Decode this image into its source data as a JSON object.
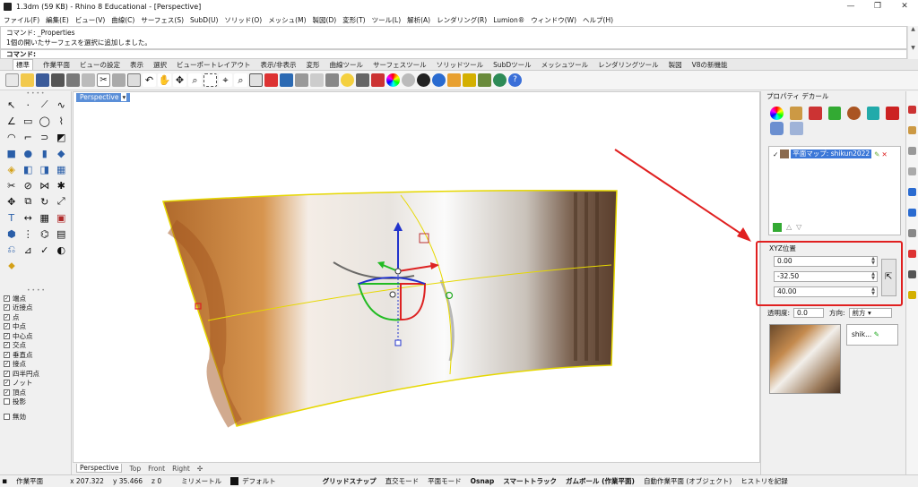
{
  "window": {
    "title": "1.3dm (59 KB) - Rhino 8 Educational - [Perspective]",
    "min": "—",
    "max": "❐",
    "close": "✕"
  },
  "menu": [
    "ファイル(F)",
    "編集(E)",
    "ビュー(V)",
    "曲線(C)",
    "サーフェス(S)",
    "SubD(U)",
    "ソリッド(O)",
    "メッシュ(M)",
    "製図(D)",
    "変形(T)",
    "ツール(L)",
    "解析(A)",
    "レンダリング(R)",
    "Lumion®",
    "ウィンドウ(W)",
    "ヘルプ(H)"
  ],
  "command": {
    "history1": "コマンド: _Properties",
    "history2": "1個の開いたサーフェスを選択に追加しました。",
    "prompt": "コマンド:"
  },
  "tabs": [
    "標準",
    "作業平面",
    "ビューの設定",
    "表示",
    "選択",
    "ビューポートレイアウト",
    "表示/非表示",
    "変形",
    "曲線ツール",
    "サーフェスツール",
    "ソリッドツール",
    "SubDツール",
    "メッシュツール",
    "レンダリングツール",
    "製図",
    "V8の新機能"
  ],
  "viewport": {
    "label": "Perspective",
    "dropdown": "▾"
  },
  "viewport_tabs": [
    "Perspective",
    "Top",
    "Front",
    "Right",
    "✣"
  ],
  "osnap": [
    {
      "label": "端点",
      "checked": true
    },
    {
      "label": "近接点",
      "checked": true
    },
    {
      "label": "点",
      "checked": true
    },
    {
      "label": "中点",
      "checked": true
    },
    {
      "label": "中心点",
      "checked": true
    },
    {
      "label": "交点",
      "checked": true
    },
    {
      "label": "垂直点",
      "checked": true
    },
    {
      "label": "接点",
      "checked": true
    },
    {
      "label": "四半円点",
      "checked": true
    },
    {
      "label": "ノット",
      "checked": true
    },
    {
      "label": "頂点",
      "checked": true
    },
    {
      "label": "投影",
      "checked": false
    },
    {
      "label": "無効",
      "checked": false
    }
  ],
  "right_panel": {
    "tabs": "プロパティ  デカール",
    "map_item": "平面マップ: shikun2022",
    "xyz_label": "XYZ位置",
    "x": "0.00",
    "y": "-32.50",
    "z": "40.00",
    "transparency_label": "透明度:",
    "transparency_value": "0.0",
    "direction_label": "方向:",
    "direction_value": "前方",
    "texture_name": "shik..."
  },
  "status": {
    "cplane": "作業平面",
    "x": "x 207.322",
    "y": "y 35.466",
    "z": "z 0",
    "unit": "ミリメートル",
    "layer": "デフォルト",
    "grid_snap": "グリッドスナップ",
    "ortho": "直交モード",
    "planar": "平面モード",
    "osnap": "Osnap",
    "smarttrack": "スマートトラック",
    "gumball": "ガムボール (作業平面)",
    "auto_cplane": "自動作業平面 (オブジェクト)",
    "history": "ヒストリを記録"
  }
}
